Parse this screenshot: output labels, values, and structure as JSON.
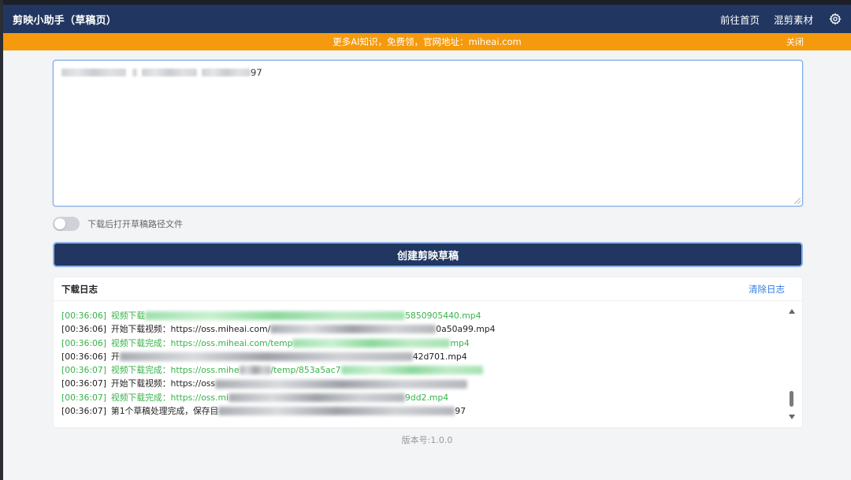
{
  "header": {
    "title": "剪映小助手（草稿页）",
    "nav": [
      "前往首页",
      "混剪素材"
    ],
    "settings_icon": "gear-icon"
  },
  "banner": {
    "text": "更多AI知识，免费领，官网地址：miheai.com",
    "close_label": "关闭",
    "color": "#f59a0c"
  },
  "draft_input": {
    "visible_suffix": "97"
  },
  "toggle": {
    "label": "下载后打开草稿路径文件",
    "on": false
  },
  "create_button": {
    "label": "创建剪映草稿"
  },
  "log": {
    "title": "下载日志",
    "clear_label": "清除日志",
    "lines": [
      {
        "time": "[00:36:06]",
        "prefix": "视频下载",
        "suffix": "5850905440.mp4",
        "status": "success"
      },
      {
        "time": "[00:36:06]",
        "prefix": "开始下载视频：https://oss.miheai.com/",
        "suffix": "0a50a99.mp4",
        "status": "info"
      },
      {
        "time": "[00:36:06]",
        "prefix": "视频下载完成：https://oss.miheai.com/temp",
        "suffix": "mp4",
        "status": "success"
      },
      {
        "time": "[00:36:06]",
        "prefix": "开",
        "suffix": "42d701.mp4",
        "status": "info"
      },
      {
        "time": "[00:36:07]",
        "prefix": "视频下载完成：https://oss.mihe",
        "suffix": "/temp/853a5ac7",
        "status": "success"
      },
      {
        "time": "[00:36:07]",
        "prefix": "开始下载视频：https://oss",
        "suffix": "",
        "status": "info"
      },
      {
        "time": "[00:36:07]",
        "prefix": "视频下载完成：https://oss.mi",
        "suffix": "9dd2.mp4",
        "status": "success"
      },
      {
        "time": "[00:36:07]",
        "prefix": "第1个草稿处理完成，保存目",
        "suffix": "97",
        "status": "info"
      }
    ]
  },
  "footer": {
    "version": "版本号:1.0.0"
  },
  "colors": {
    "primary": "#213761",
    "accent_blue": "#2f7be0",
    "success": "#37b34a"
  }
}
